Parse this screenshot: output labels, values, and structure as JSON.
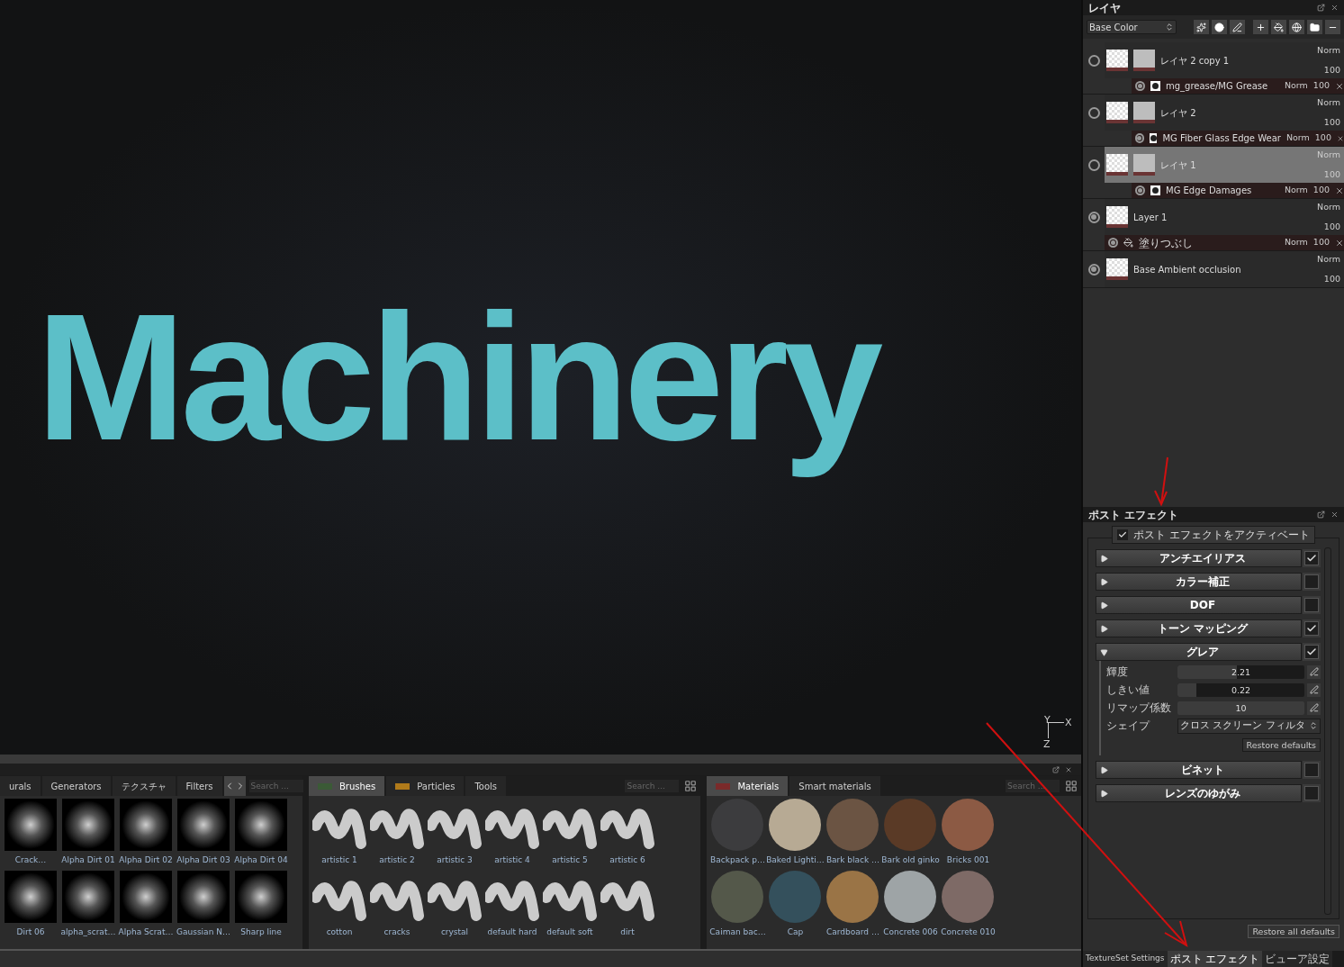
{
  "viewport": {
    "model_text": "Machinery",
    "gizmo": {
      "y": "Y",
      "x": "X",
      "z": "Z"
    }
  },
  "shelves": [
    {
      "kind": "alphas",
      "tabs": [
        {
          "label": "urals",
          "selected": false
        },
        {
          "label": "Generators",
          "selected": false
        },
        {
          "label": "テクスチャ",
          "selected": false
        },
        {
          "label": "Filters",
          "selected": false
        }
      ],
      "search": {
        "placeholder": "Search ..."
      },
      "items": [
        {
          "label": "Crack…"
        },
        {
          "label": "Alpha Dirt 01"
        },
        {
          "label": "Alpha Dirt 02"
        },
        {
          "label": "Alpha Dirt 03"
        },
        {
          "label": "Alpha Dirt 04"
        },
        {
          "label": "Dirt 06"
        },
        {
          "label": "alpha_scrat…"
        },
        {
          "label": "Alpha Scrat…"
        },
        {
          "label": "Gaussian N…"
        },
        {
          "label": "Sharp line"
        }
      ]
    },
    {
      "kind": "brushes",
      "tabs": [
        {
          "label": "Brushes",
          "selected": true,
          "color": "#3b5a36"
        },
        {
          "label": "Particles",
          "selected": false,
          "color": "#b07a1a"
        },
        {
          "label": "Tools",
          "selected": false
        }
      ],
      "search": {
        "placeholder": "Search ..."
      },
      "items": [
        {
          "label": "artistic 1"
        },
        {
          "label": "artistic 2"
        },
        {
          "label": "artistic 3"
        },
        {
          "label": "artistic 4"
        },
        {
          "label": "artistic 5"
        },
        {
          "label": "artistic 6"
        },
        {
          "label": "cotton"
        },
        {
          "label": "cracks"
        },
        {
          "label": "crystal"
        },
        {
          "label": "default hard"
        },
        {
          "label": "default soft"
        },
        {
          "label": "dirt"
        }
      ]
    },
    {
      "kind": "materials",
      "tabs": [
        {
          "label": "Materials",
          "selected": true,
          "color": "#7a2a2a"
        },
        {
          "label": "Smart materials",
          "selected": false
        }
      ],
      "search": {
        "placeholder": "Search ..."
      },
      "items": [
        {
          "label": "Backpack p…",
          "color": "#3c3c3e"
        },
        {
          "label": "Baked Lighti…",
          "color": "#b7aa94"
        },
        {
          "label": "Bark black …",
          "color": "#6b5443"
        },
        {
          "label": "Bark old ginko",
          "color": "#5a3a26"
        },
        {
          "label": "Bricks 001",
          "color": "#8c5a44"
        },
        {
          "label": "Caiman bac…",
          "color": "#54584a"
        },
        {
          "label": "Cap",
          "color": "#34505c"
        },
        {
          "label": "Cardboard …",
          "color": "#9a7446"
        },
        {
          "label": "Concrete 006",
          "color": "#9ea4a6"
        },
        {
          "label": "Concrete 010",
          "color": "#7e6a66"
        }
      ]
    }
  ],
  "layers_panel": {
    "title": "レイヤ",
    "channel": "Base Color",
    "layers": [
      {
        "name": "レイヤ 2 copy 1",
        "kind": "masked",
        "visible": false,
        "selected": false,
        "blend": "Norm",
        "opacity": "100",
        "effects": [
          {
            "name": "mg_grease/MG Grease",
            "kind": "filter",
            "blend": "Norm",
            "opacity": "100"
          }
        ]
      },
      {
        "name": "レイヤ 2",
        "kind": "masked",
        "visible": false,
        "selected": false,
        "blend": "Norm",
        "opacity": "100",
        "effects": [
          {
            "name": "MG Fiber Glass Edge Wear",
            "kind": "filter",
            "blend": "Norm",
            "opacity": "100"
          }
        ]
      },
      {
        "name": "レイヤ 1",
        "kind": "masked",
        "visible": false,
        "selected": true,
        "blend": "Norm",
        "opacity": "100",
        "effects": [
          {
            "name": "MG Edge Damages",
            "kind": "filter",
            "blend": "Norm",
            "opacity": "100"
          }
        ]
      },
      {
        "name": "Layer 1",
        "kind": "plain",
        "visible": true,
        "selected": false,
        "blend": "Norm",
        "opacity": "100",
        "effects": [
          {
            "name": "塗りつぶし",
            "kind": "fill",
            "blend": "Norm",
            "opacity": "100"
          }
        ]
      },
      {
        "name": "Base Ambient occlusion",
        "kind": "plain",
        "visible": true,
        "selected": false,
        "blend": "Norm",
        "opacity": "100"
      }
    ]
  },
  "post_effects": {
    "title": "ポスト エフェクト",
    "activate": {
      "label": "ポスト エフェクトをアクティベート",
      "checked": true
    },
    "sections": [
      {
        "label": "アンチエイリアス",
        "expanded": false,
        "checked": true
      },
      {
        "label": "カラー補正",
        "expanded": false,
        "checked": false
      },
      {
        "label": "DOF",
        "expanded": false,
        "checked": false
      },
      {
        "label": "トーン マッピング",
        "expanded": false,
        "checked": true
      },
      {
        "label": "グレア",
        "expanded": true,
        "checked": true,
        "params": [
          {
            "kind": "slider",
            "label": "輝度",
            "value": "2.21",
            "level": 0.47
          },
          {
            "kind": "slider",
            "label": "しきい値",
            "value": "0.22",
            "level": 0.15
          },
          {
            "kind": "slider",
            "label": "リマップ係数",
            "value": "10",
            "level": 1
          },
          {
            "kind": "dropdown",
            "label": "シェイプ",
            "value": "クロス スクリーン フィルタ"
          }
        ],
        "restore": "Restore defaults"
      },
      {
        "label": "ビネット",
        "expanded": false,
        "checked": false
      },
      {
        "label": "レンズのゆがみ",
        "expanded": false,
        "checked": false
      }
    ],
    "restore_all": "Restore all defaults"
  },
  "bottom_tabs": [
    {
      "label": "TextureSet Settings",
      "selected": false
    },
    {
      "label": "ポスト エフェクト",
      "selected": true
    },
    {
      "label": "ビューア設定",
      "selected": false
    }
  ]
}
